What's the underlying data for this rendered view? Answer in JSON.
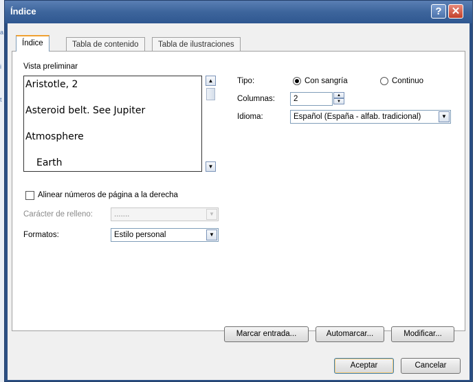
{
  "window": {
    "title": "Índice",
    "help": "?",
    "close": "✕"
  },
  "tabs": [
    {
      "label": "Índice",
      "active": true
    },
    {
      "label": "Tabla de contenido",
      "active": false
    },
    {
      "label": "Tabla de ilustraciones",
      "active": false
    }
  ],
  "preview": {
    "label": "Vista preliminar",
    "lines": [
      "Aristotle, 2",
      "Asteroid belt. See Jupiter",
      "Atmosphere",
      "Earth"
    ]
  },
  "options": {
    "tipo_label": "Tipo:",
    "tipo_options": [
      "Con sangría",
      "Continuo"
    ],
    "tipo_selected": "Con sangría",
    "columnas_label": "Columnas:",
    "columnas_value": "2",
    "idioma_label": "Idioma:",
    "idioma_value": "Español (España - alfab. tradicional)"
  },
  "align": {
    "label": "Alinear números de página a la derecha",
    "checked": false
  },
  "relleno": {
    "label": "Carácter de relleno:",
    "value": ".......",
    "enabled": false
  },
  "formatos": {
    "label": "Formatos:",
    "value": "Estilo personal"
  },
  "buttons": {
    "marcar": "Marcar entrada...",
    "automarcar": "Automarcar...",
    "modificar": "Modificar...",
    "aceptar": "Aceptar",
    "cancelar": "Cancelar"
  },
  "colors": {
    "titlebar": "#3d659c",
    "accent": "#f0a030"
  }
}
